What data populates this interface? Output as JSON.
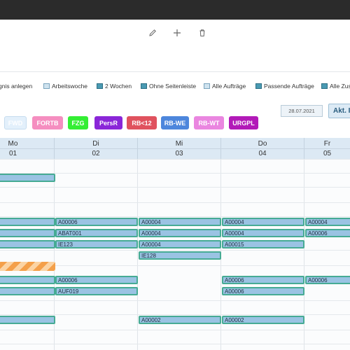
{
  "toolbar": {
    "items": [
      {
        "label": "gnis anlegen",
        "icon": "calendar-icon"
      },
      {
        "label": "Arbeitswoche",
        "icon": "calendar-week-icon"
      },
      {
        "label": "2 Wochen",
        "icon": "calendar-two-weeks-icon"
      },
      {
        "label": "Ohne Seitenleiste",
        "icon": "sidebar-hide-icon"
      },
      {
        "label": "Alle Aufträge",
        "icon": "list-icon"
      },
      {
        "label": "Passende Aufträge",
        "icon": "filter-icon"
      },
      {
        "label": "Alle Zus",
        "icon": "list-icon"
      }
    ]
  },
  "actions": {
    "edit_icon": "pencil-icon",
    "add_icon": "plus-icon",
    "delete_icon": "trash-icon"
  },
  "legend": [
    {
      "label": "FWD",
      "bg": "#e3f0fb",
      "fg": "#ffffff",
      "border": "#c5dcef"
    },
    {
      "label": "FORTB",
      "bg": "#f58ec0",
      "fg": "#ffffff",
      "border": "#f58ec0"
    },
    {
      "label": "FZG",
      "bg": "#34ee34",
      "fg": "#ffffff",
      "border": "#34ee34"
    },
    {
      "label": "PersR",
      "bg": "#8a26d8",
      "fg": "#ffffff",
      "border": "#8a26d8"
    },
    {
      "label": "RB<12",
      "bg": "#e0525e",
      "fg": "#ffffff",
      "border": "#e0525e"
    },
    {
      "label": "RB-WE",
      "bg": "#4d86dc",
      "fg": "#ffffff",
      "border": "#4d86dc"
    },
    {
      "label": "RB-WT",
      "bg": "#ea86e0",
      "fg": "#ffffff",
      "border": "#ea86e0"
    },
    {
      "label": "URGPL",
      "bg": "#b21ab8",
      "fg": "#ffffff",
      "border": "#b21ab8"
    }
  ],
  "date_field": {
    "value": "28.07.2021"
  },
  "today_button": {
    "label": "Akt. I"
  },
  "days": [
    {
      "day": "Mo",
      "num": "01"
    },
    {
      "day": "Di",
      "num": "02"
    },
    {
      "day": "Mi",
      "num": "03"
    },
    {
      "day": "Do",
      "num": "04"
    },
    {
      "day": "Fr",
      "num": "05"
    }
  ],
  "events": [
    {
      "label": "",
      "col": 0,
      "row": 0
    },
    {
      "label": "A00006",
      "col": 1,
      "row": 1
    },
    {
      "label": "A00004",
      "col": 2,
      "row": 1
    },
    {
      "label": "A00004",
      "col": 3,
      "row": 1
    },
    {
      "label": "A00004",
      "col": 4,
      "row": 1
    },
    {
      "label": "",
      "col": 0,
      "row": 1
    },
    {
      "label": "ABAT001",
      "col": 1,
      "row": 2
    },
    {
      "label": "A00004",
      "col": 2,
      "row": 2
    },
    {
      "label": "A00004",
      "col": 3,
      "row": 2
    },
    {
      "label": "A00006",
      "col": 4,
      "row": 2
    },
    {
      "label": "",
      "col": 0,
      "row": 2
    },
    {
      "label": "IE123",
      "col": 1,
      "row": 3
    },
    {
      "label": "A00004",
      "col": 2,
      "row": 3
    },
    {
      "label": "A00015",
      "col": 3,
      "row": 3
    },
    {
      "label": "",
      "col": 0,
      "row": 3
    },
    {
      "label": "IE128",
      "col": 2,
      "row": 4
    },
    {
      "label": "",
      "col": 0,
      "row": 5,
      "striped": true
    },
    {
      "label": "A00006",
      "col": 1,
      "row": 6
    },
    {
      "label": "",
      "col": 0,
      "row": 6
    },
    {
      "label": "A00006",
      "col": 3,
      "row": 6
    },
    {
      "label": "A00006",
      "col": 4,
      "row": 6
    },
    {
      "label": "AUF019",
      "col": 1,
      "row": 7
    },
    {
      "label": "",
      "col": 0,
      "row": 7
    },
    {
      "label": "A00006",
      "col": 3,
      "row": 7
    },
    {
      "label": "",
      "col": 0,
      "row": 8
    },
    {
      "label": "A00002",
      "col": 2,
      "row": 8
    },
    {
      "label": "A00002",
      "col": 3,
      "row": 8
    }
  ]
}
